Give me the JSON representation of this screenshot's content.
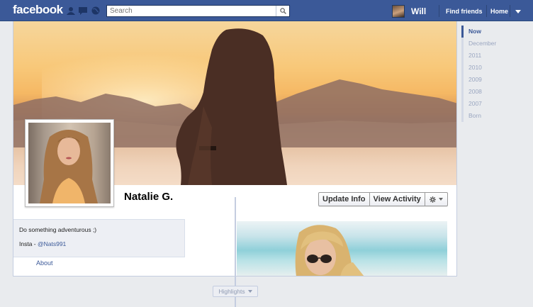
{
  "topbar": {
    "logo": "facebook",
    "search_placeholder": "Search",
    "user_name": "Will",
    "find_friends": "Find friends",
    "home": "Home"
  },
  "profile": {
    "name": "Natalie G.",
    "bio": {
      "line1": "Do something adventurous ;)",
      "insta_label": "Insta - ",
      "insta_handle": "@Nats991"
    },
    "about": "About"
  },
  "actions": {
    "update_info": "Update Info",
    "view_activity": "View Activity"
  },
  "timeline_nav": [
    "Now",
    "December",
    "2011",
    "2010",
    "2009",
    "2008",
    "2007",
    "Born"
  ],
  "highlights": "Highlights",
  "colors": {
    "brand": "#3b5998",
    "page_bg": "#e9ebee"
  }
}
